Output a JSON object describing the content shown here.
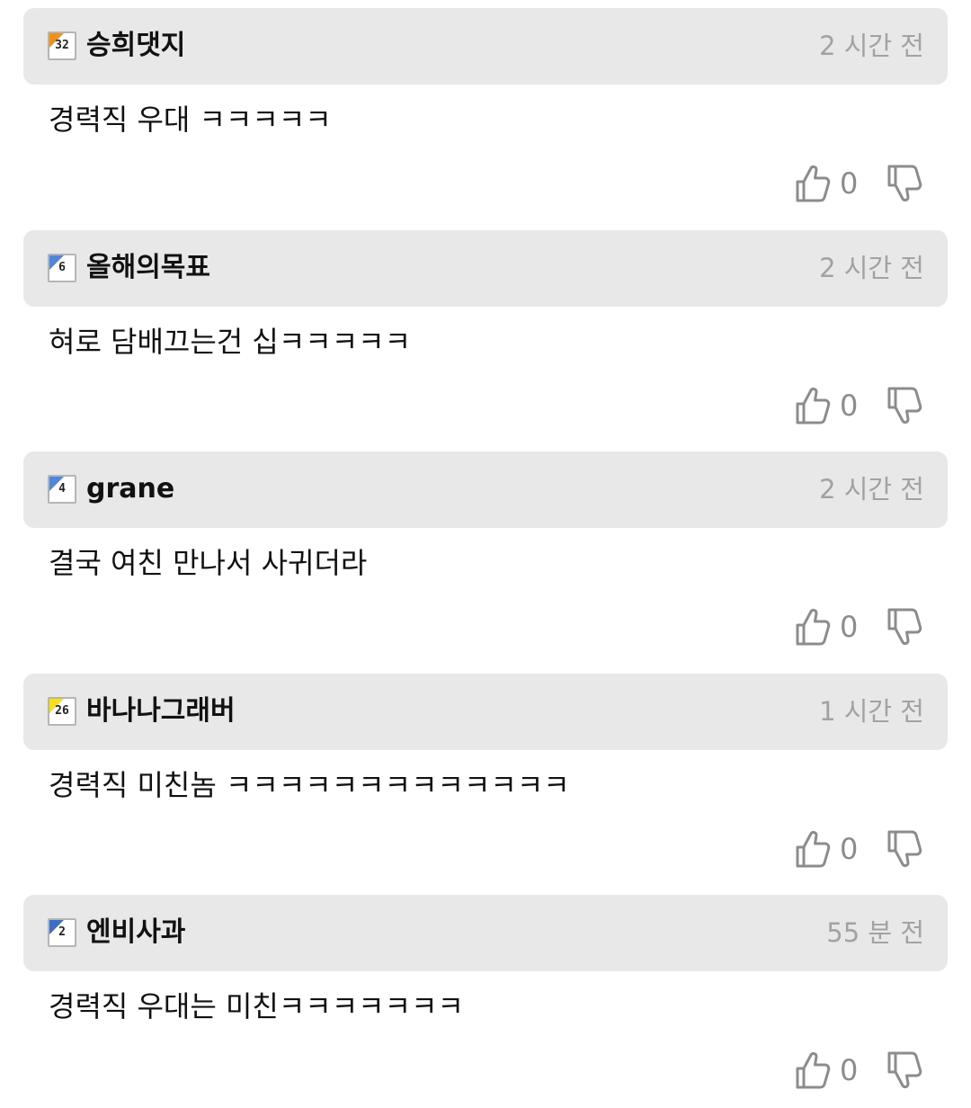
{
  "comments": [
    {
      "username": "승희댓지",
      "level": "32",
      "level_color": "#f0901c",
      "time": "2 시간 전",
      "text": "경력직 우대 ㅋㅋㅋㅋㅋ",
      "likes": "0"
    },
    {
      "username": "올해의목표",
      "level": "6",
      "level_color": "#4f86d9",
      "time": "2 시간 전",
      "text": "혀로 담배끄는건 십ㅋㅋㅋㅋㅋ",
      "likes": "0"
    },
    {
      "username": "grane",
      "level": "4",
      "level_color": "#4f86d9",
      "time": "2 시간 전",
      "text": "결국 여친 만나서 사귀더라",
      "likes": "0"
    },
    {
      "username": "바나나그래버",
      "level": "26",
      "level_color": "#f5e01a",
      "time": "1 시간 전",
      "text": "경력직 미친놈 ㅋㅋㅋㅋㅋㅋㅋㅋㅋㅋㅋㅋㅋ",
      "likes": "0"
    },
    {
      "username": "엔비사과",
      "level": "2",
      "level_color": "#3a6fc4",
      "time": "55 분 전",
      "text": "경력직 우대는 미친ㅋㅋㅋㅋㅋㅋㅋ",
      "likes": "0"
    }
  ],
  "icons": {
    "like": "thumbs-up-icon",
    "dislike": "thumbs-down-icon",
    "level": "level-badge-icon"
  },
  "colors": {
    "header_bg": "#e8e8e8",
    "time_text": "#a2a2a2",
    "vote_icon": "#8c8c8c"
  }
}
